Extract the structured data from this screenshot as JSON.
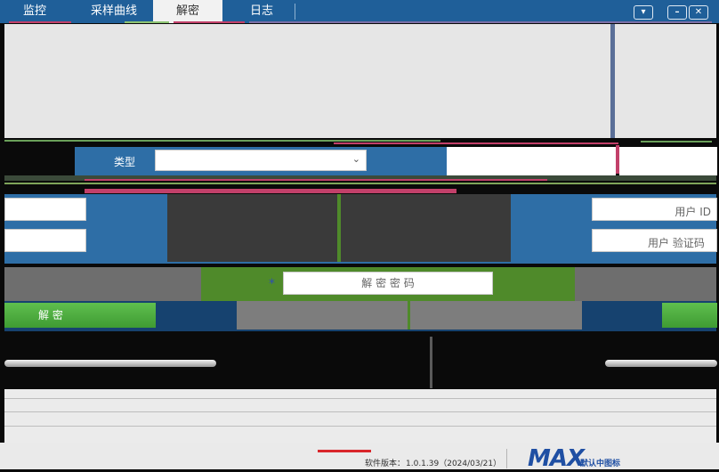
{
  "tabs": [
    {
      "label": "监控",
      "active": false
    },
    {
      "label": "采样曲线",
      "active": false
    },
    {
      "label": "解密",
      "active": true
    },
    {
      "label": "日志",
      "active": false
    }
  ],
  "window_controls": {
    "dropdown": "▾",
    "minimize": "–",
    "close": "✕"
  },
  "form": {
    "type_label": "类型",
    "type_value": "",
    "user_id_placeholder": "用户 ID",
    "user_code_placeholder": "用户 验证码",
    "required_marker": "*",
    "password_placeholder": "解 密 密 码",
    "decrypt_button": "解 密"
  },
  "footer": {
    "version_label": "软件版本：",
    "version_value": "1.0.1.39（2024/03/21）",
    "logo_text": "MAX",
    "logo_sub": "默认中图标"
  },
  "colors": {
    "tab_bar": "#1f5f99",
    "accent_blue": "#2e6ea6",
    "green_button": "#3f9b33",
    "password_panel": "#4f8a2a",
    "logo_blue": "#1f4fa3",
    "logo_red": "#d9262b"
  }
}
